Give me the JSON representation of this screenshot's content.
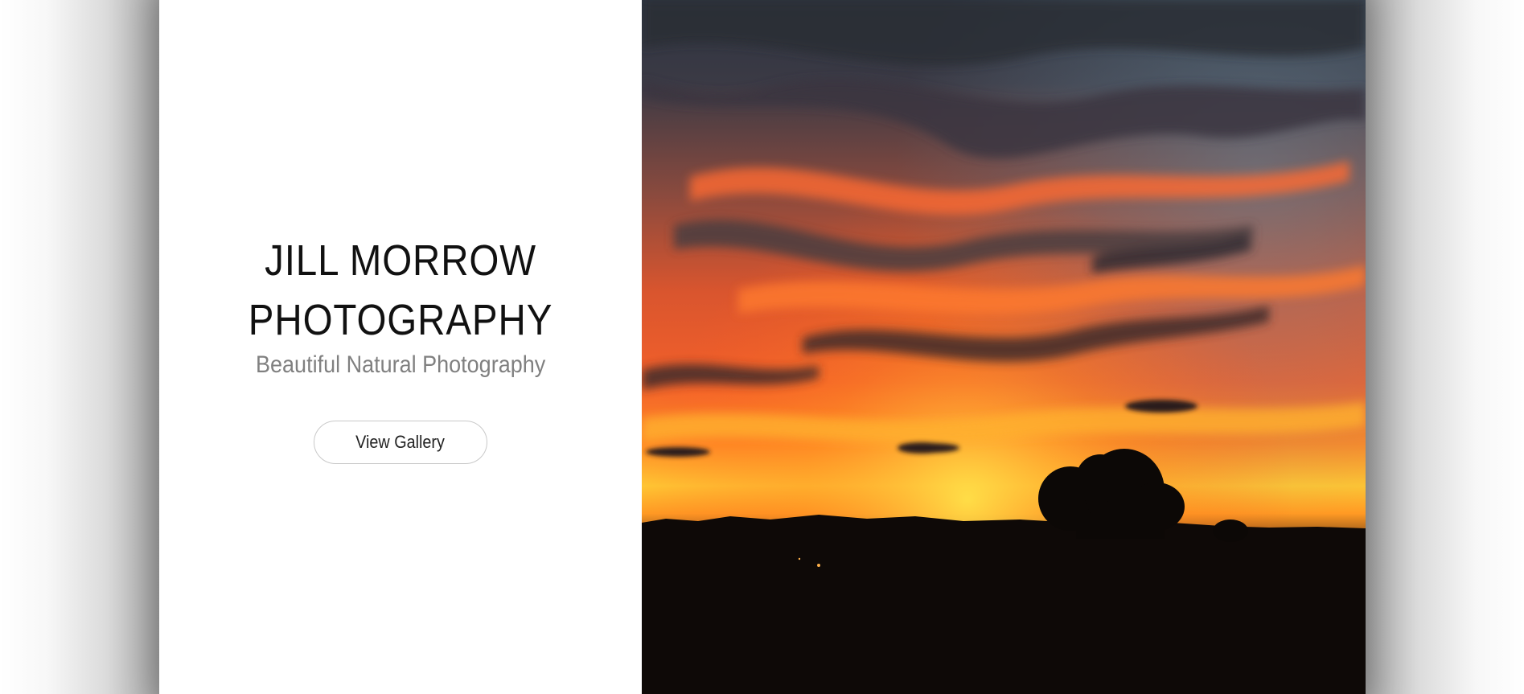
{
  "hero": {
    "title_line1": "JILL MORROW",
    "title_line2": "PHOTOGRAPHY",
    "subtitle": "Beautiful Natural Photography",
    "button_label": "View Gallery"
  },
  "colors": {
    "title": "#111111",
    "subtitle": "#808080",
    "button_border": "#c9c9c9",
    "sky_orange": "#ff5a1f",
    "sky_yellow": "#ffd23a",
    "cloud_dark": "#3a3640"
  },
  "photo": {
    "subject": "sunset-over-treeline"
  }
}
